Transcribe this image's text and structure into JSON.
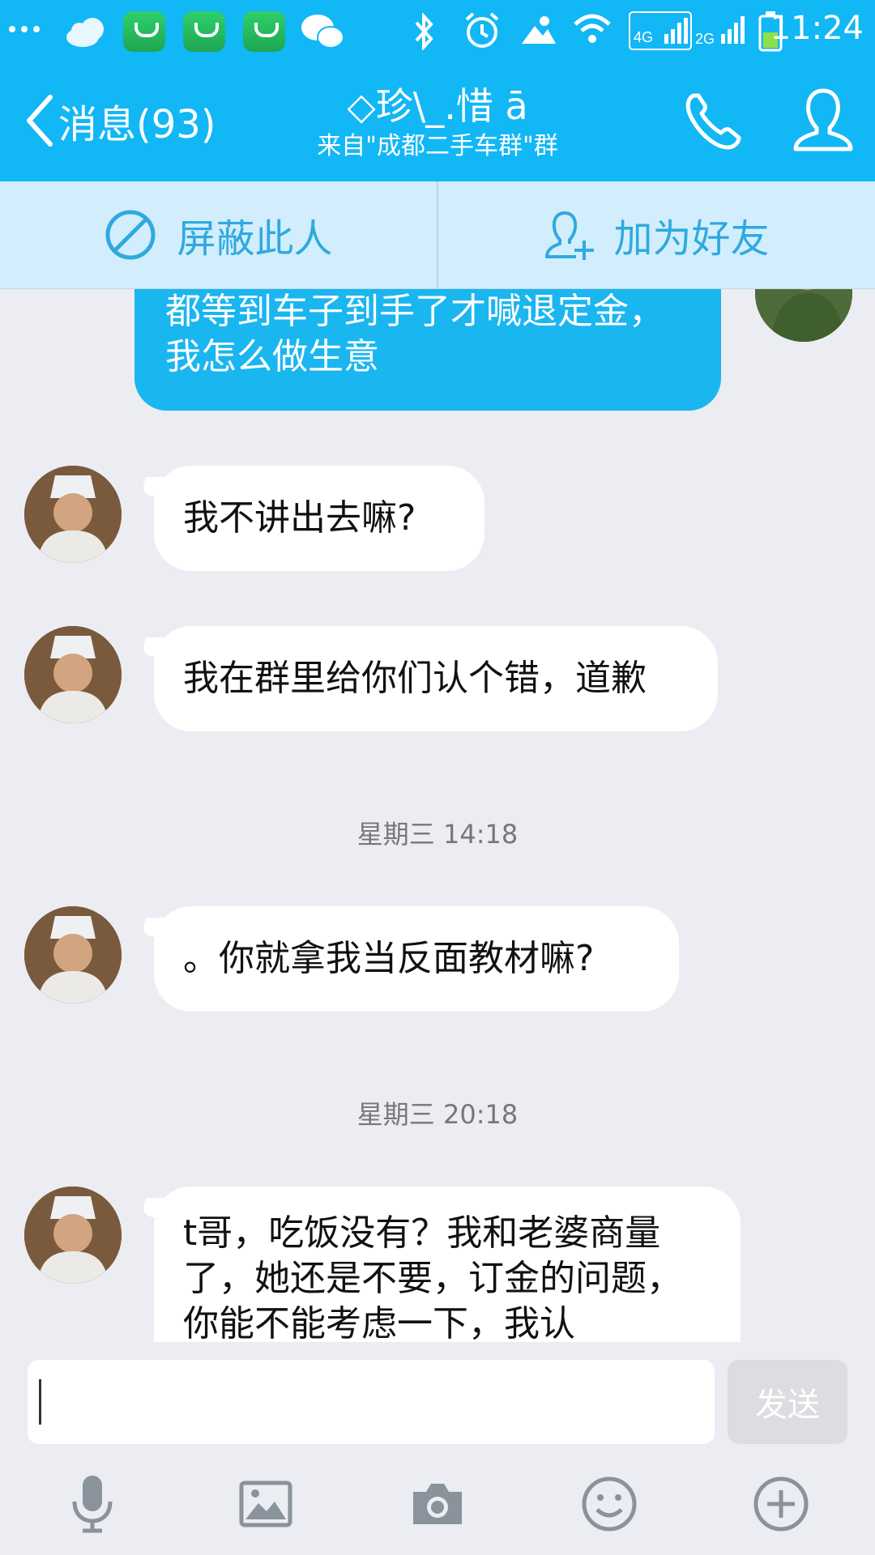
{
  "status_bar": {
    "time": "11:24",
    "network_1": "4G",
    "network_2": "2G"
  },
  "header": {
    "back_label": "消息(93)",
    "title": "◇珍\\_.惜 ā",
    "subtitle": "来自\"成都二手车群\"群"
  },
  "actions": {
    "block_label": "屏蔽此人",
    "add_friend_label": "加为好友"
  },
  "messages": {
    "m0": "都等到车子到手了才喊退定金，我怎么做生意",
    "m1": "我不讲出去嘛?",
    "m2": "我在群里给你们认个错，道歉",
    "t1": "星期三 14:18",
    "m3": "。你就拿我当反面教材嘛?",
    "t2": "星期三 20:18",
    "m4": "t哥，吃饭没有？我和老婆商量了，她还是不要，订金的问题，你能不能考虑一下，我认"
  },
  "composer": {
    "send_label": "发送"
  },
  "colors": {
    "accent": "#12b7f5",
    "action_bar": "#d2eefc",
    "outgoing_bubble": "#1ab6f0",
    "background": "#ebedf2"
  }
}
